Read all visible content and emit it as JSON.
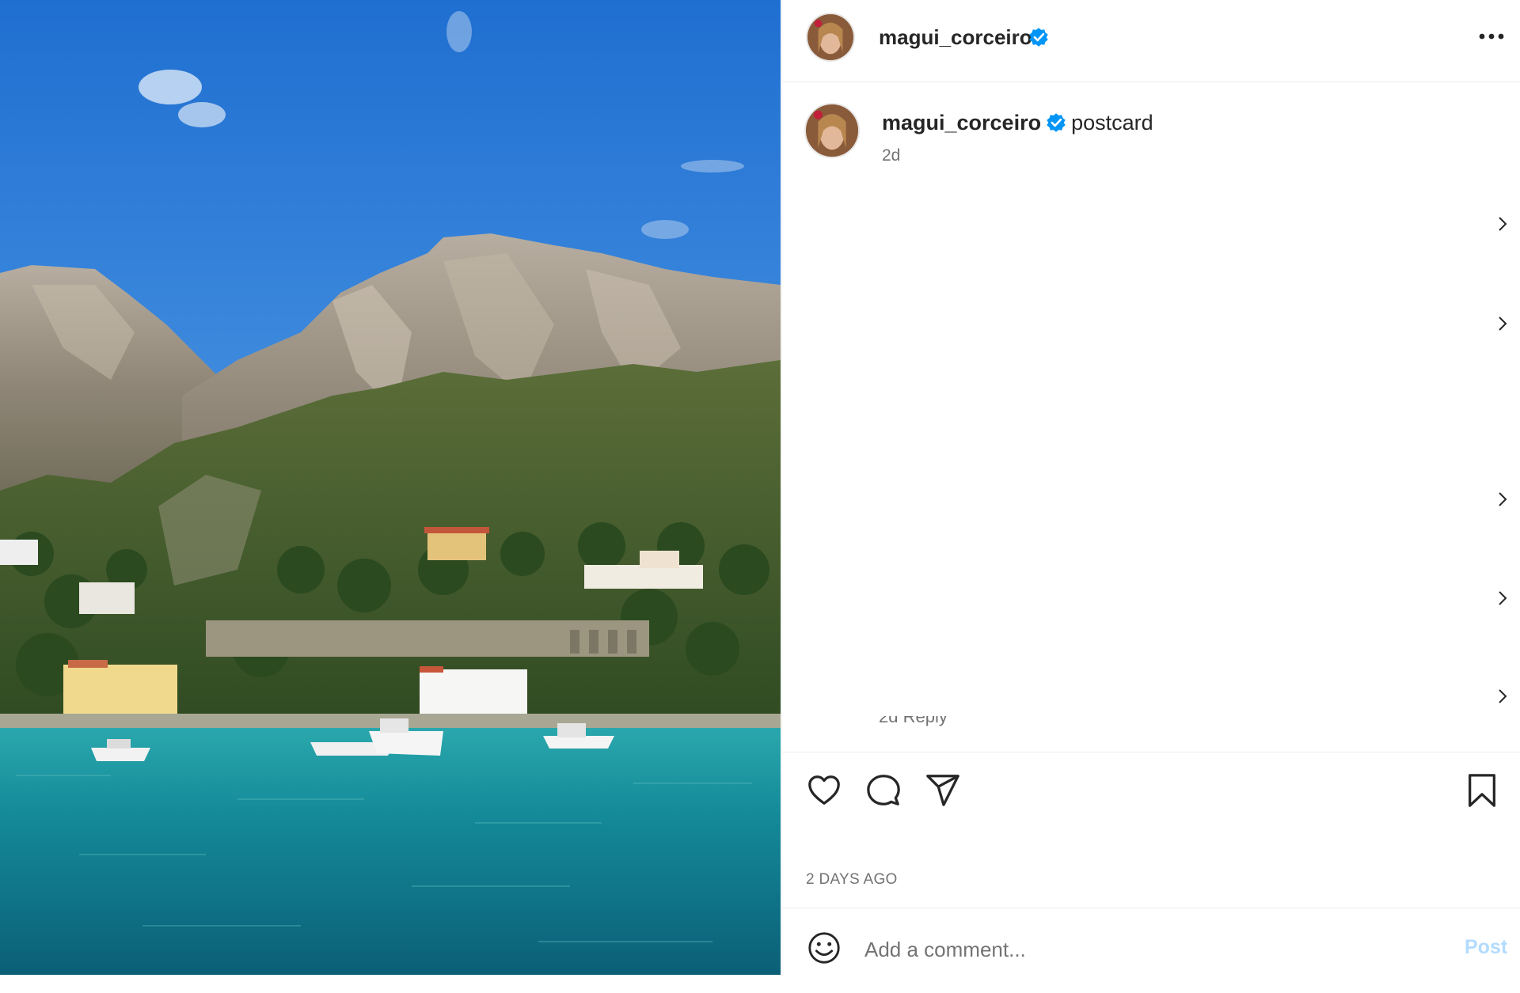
{
  "post": {
    "username": "magui_corceiro",
    "caption": "postcard",
    "caption_time": "2d",
    "date": "2 DAYS AGO",
    "truncated_reply": "2d   Reply"
  },
  "photo": {
    "alt": "Coastal cliffs above turquoise sea with white villas and moored boats"
  },
  "comment_box": {
    "placeholder": "Add a comment...",
    "post_label": "Post"
  },
  "icons": [
    "verified-badge-icon",
    "more-options-icon",
    "chevron-right-icon",
    "heart-icon",
    "comment-bubble-icon",
    "share-plane-icon",
    "bookmark-icon",
    "emoji-icon"
  ],
  "colors": {
    "verified": "#0095f6",
    "post_button_disabled": "#b3dbff",
    "secondary_text": "#737373",
    "primary_text": "#262626",
    "divider": "#efefef"
  }
}
